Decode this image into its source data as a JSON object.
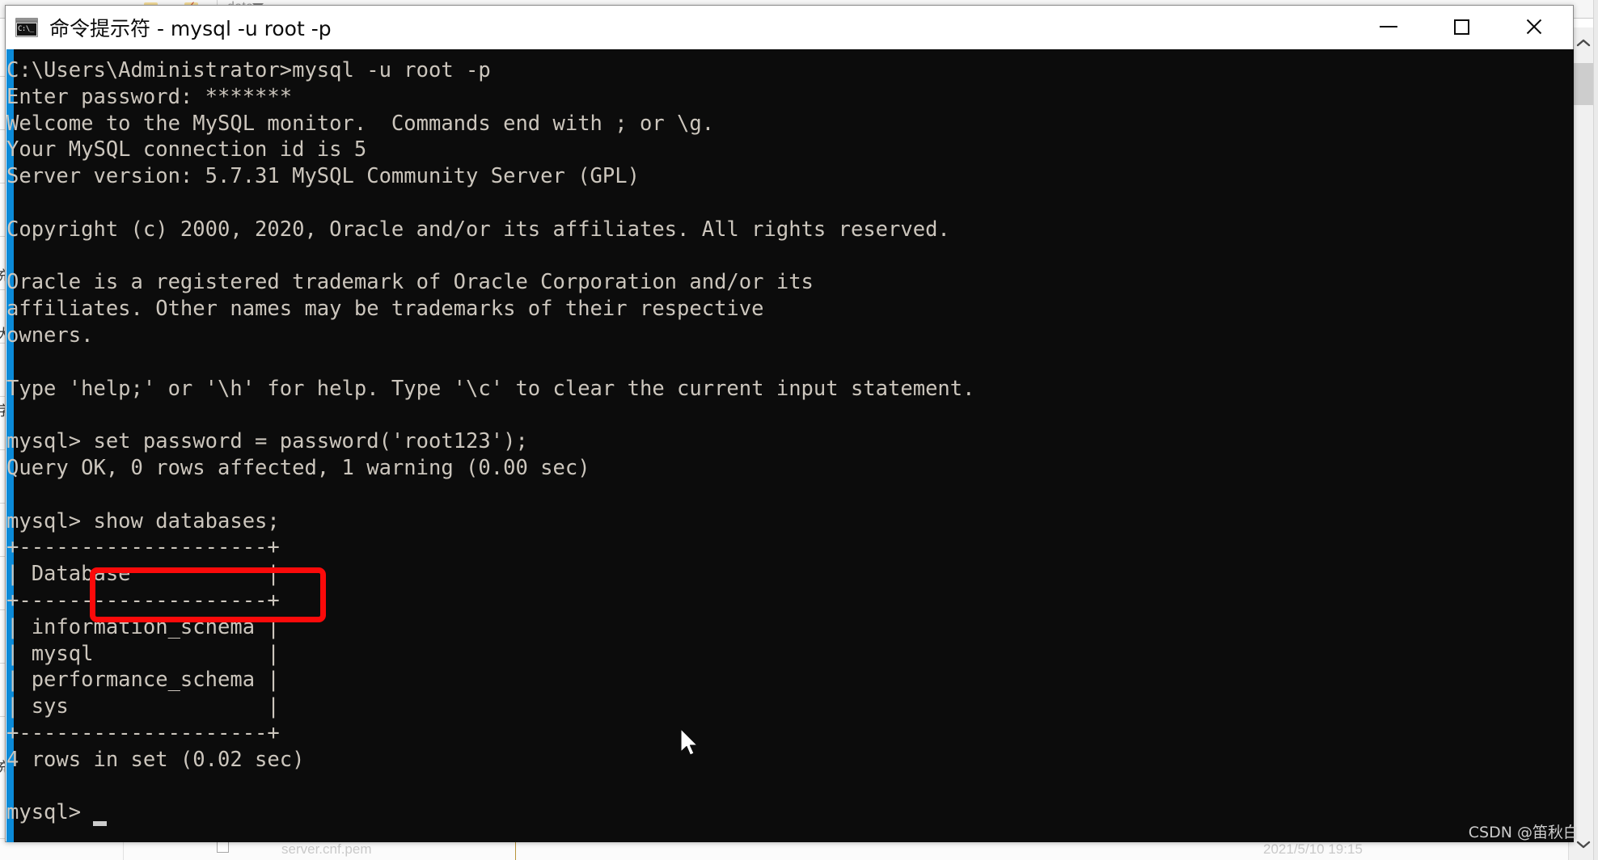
{
  "window": {
    "title": "命令提示符 - mysql  -u root -p",
    "icon_name": "cmd-icon",
    "icon_text": "C:\\_",
    "controls": {
      "minimize_label": "—",
      "maximize_label": "□",
      "close_label": "✕"
    }
  },
  "console": {
    "background_color": "#0c0c0c",
    "text_color": "#ccc6bd",
    "accent_color": "#0b8ad8",
    "lines": [
      "C:\\Users\\Administrator>mysql -u root -p",
      "Enter password: *******",
      "Welcome to the MySQL monitor.  Commands end with ; or \\g.",
      "Your MySQL connection id is 5",
      "Server version: 5.7.31 MySQL Community Server (GPL)",
      "",
      "Copyright (c) 2000, 2020, Oracle and/or its affiliates. All rights reserved.",
      "",
      "Oracle is a registered trademark of Oracle Corporation and/or its",
      "affiliates. Other names may be trademarks of their respective",
      "owners.",
      "",
      "Type 'help;' or '\\h' for help. Type '\\c' to clear the current input statement.",
      "",
      "mysql> set password = password('root123');",
      "Query OK, 0 rows affected, 1 warning (0.00 sec)",
      "",
      "mysql> show databases;",
      "+--------------------+",
      "| Database           |",
      "+--------------------+",
      "| information_schema |",
      "| mysql              |",
      "| performance_schema |",
      "| sys                |",
      "+--------------------+",
      "4 rows in set (0.02 sec)",
      "",
      "mysql>"
    ],
    "prompt": "mysql>",
    "cursor_visible": true
  },
  "query_result": {
    "command": "show databases;",
    "column_header": "Database",
    "rows": [
      "information_schema",
      "mysql",
      "performance_schema",
      "sys"
    ],
    "row_count_text": "4 rows in set (0.02 sec)"
  },
  "annotation": {
    "color": "#fb0a0a",
    "highlighted_text": "show databases;"
  },
  "background": {
    "path_text": "data",
    "left_column_chars": [
      "充",
      "大",
      "字"
    ],
    "bottom_text_left": "server.cnf.pem",
    "bottom_text_right": "2021/5/10 19:15",
    "scrollbar": {
      "up_arrow": "⌃",
      "down_arrow": "⌄"
    }
  },
  "watermark": {
    "text": "CSDN @笛秋白"
  }
}
